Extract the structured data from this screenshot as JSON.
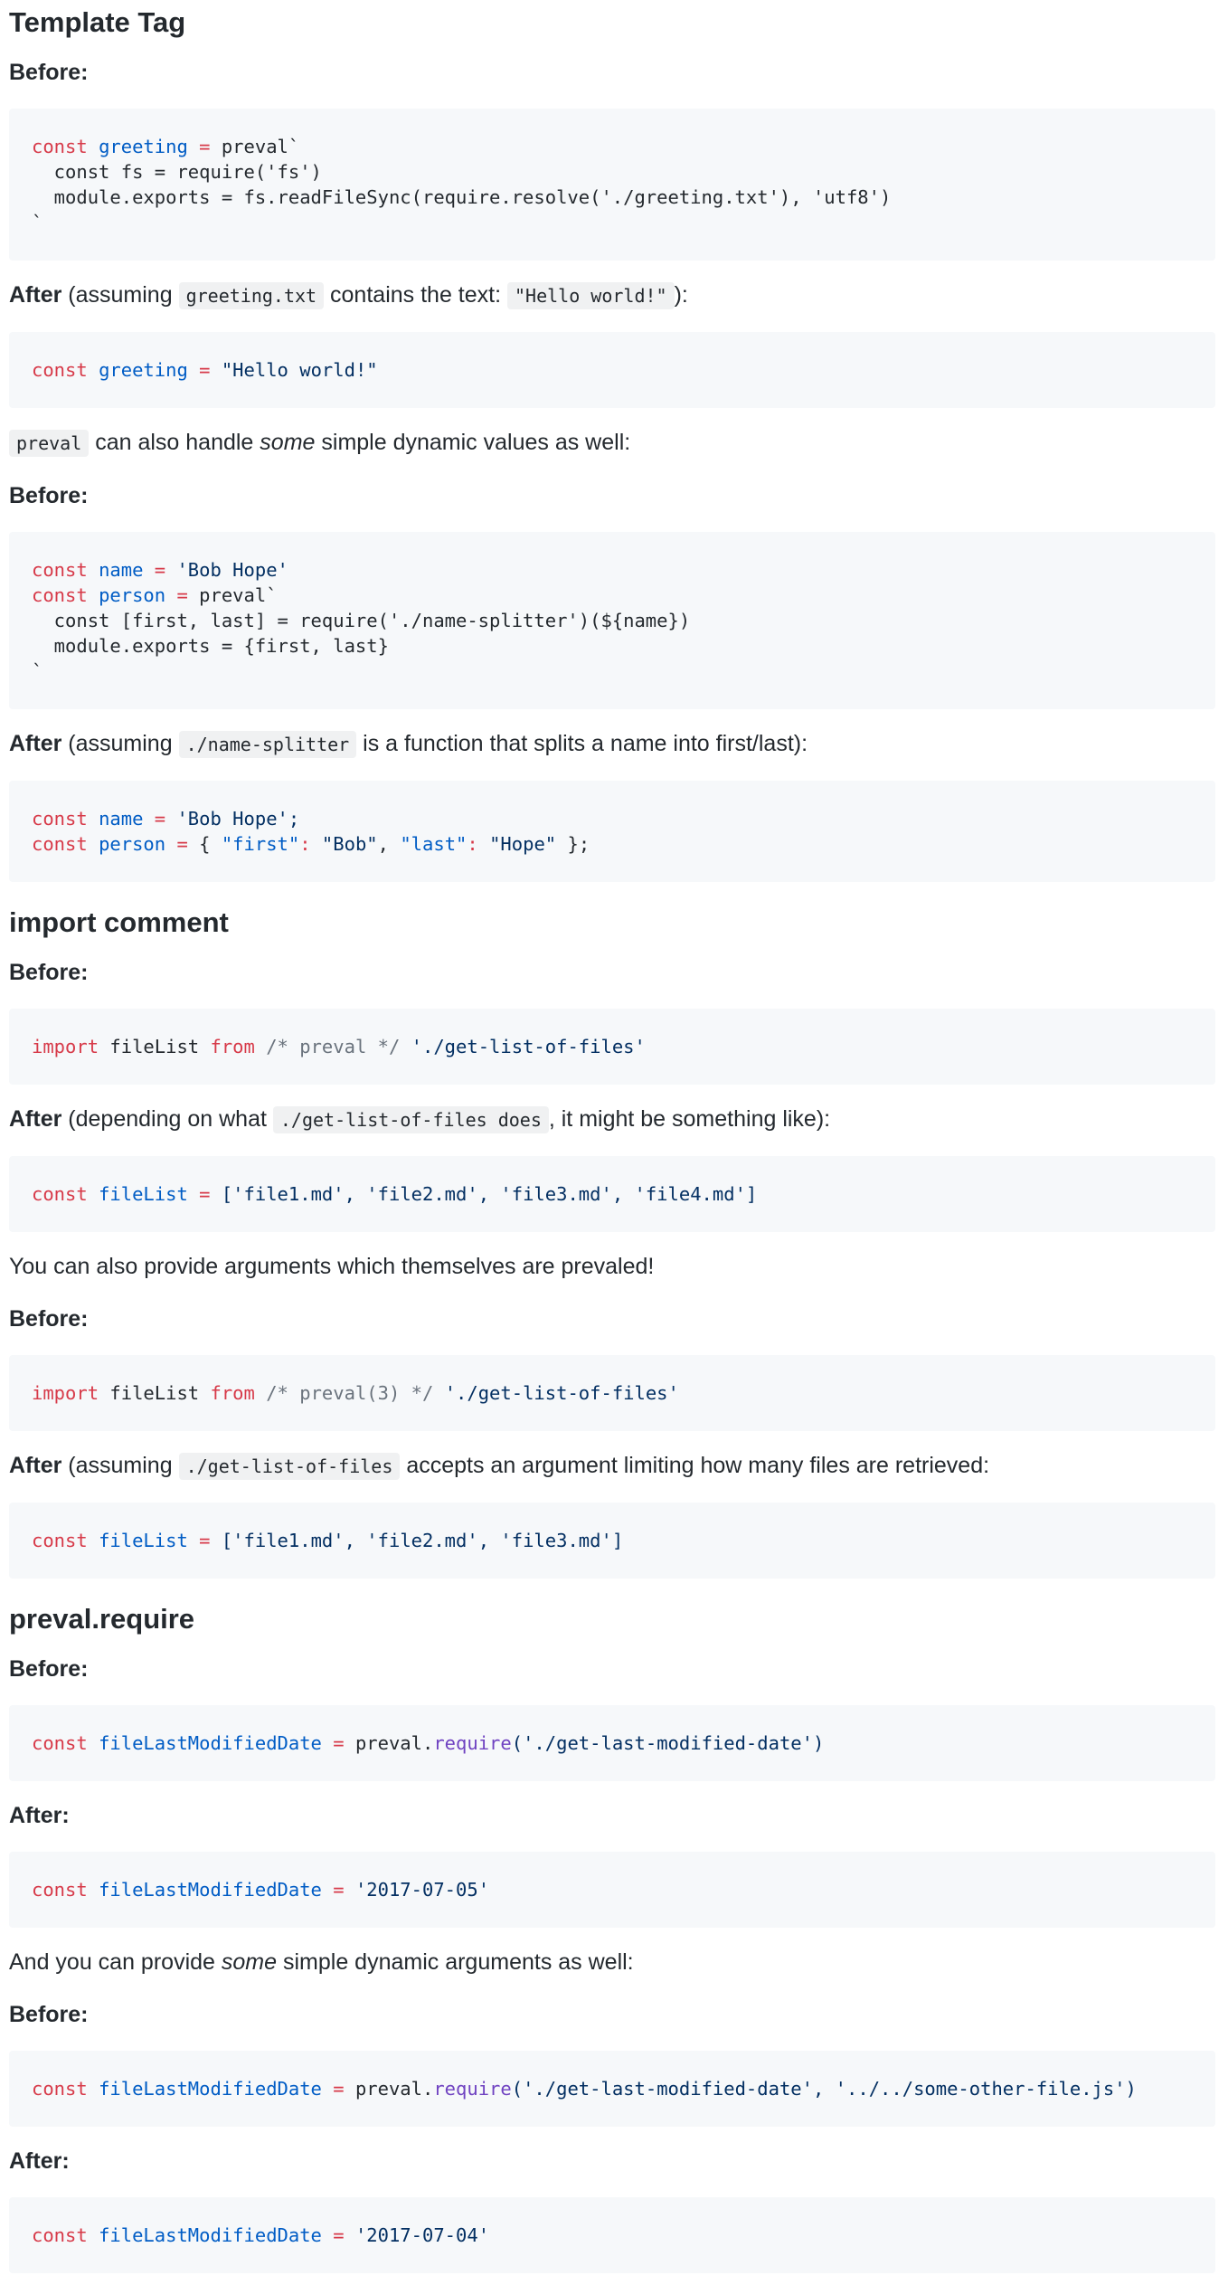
{
  "sections": {
    "template_tag": {
      "heading": "Template Tag",
      "before_label": "Before:",
      "code1": {
        "kw": "const",
        "var": "greeting",
        "eq": "=",
        "rest": "preval`",
        "line2": "  const fs = require('fs')",
        "line3": "  module.exports = fs.readFileSync(require.resolve('./greeting.txt'), 'utf8')",
        "line4": "`"
      },
      "after_label": "After",
      "after_text_1": "(assuming",
      "after_code_1": "greeting.txt",
      "after_text_2": "contains the text:",
      "after_code_2": "\"Hello world!\"",
      "after_text_3": "):",
      "code2": {
        "kw": "const",
        "var": "greeting",
        "eq": "=",
        "str": "\"Hello world!\""
      },
      "dyn_code": "preval",
      "dyn_text_1": "can also handle",
      "dyn_em": "some",
      "dyn_text_2": "simple dynamic values as well:",
      "before_label_2": "Before:",
      "code3": {
        "l1_kw": "const",
        "l1_var": "name",
        "l1_eq": "=",
        "l1_str": "'Bob Hope'",
        "l2_kw": "const",
        "l2_var": "person",
        "l2_eq": "=",
        "l2_rest": "preval`",
        "line3": "  const [first, last] = require('./name-splitter')(${name})",
        "line4": "  module.exports = {first, last}",
        "line5": "`"
      },
      "after_label_2": "After",
      "after2_text_1": "(assuming",
      "after2_code": "./name-splitter",
      "after2_text_2": "is a function that splits a name into first/last):",
      "code4": {
        "l1_kw": "const",
        "l1_var": "name",
        "l1_eq": "=",
        "l1_str": "'Bob Hope';",
        "l2_kw": "const",
        "l2_var": "person",
        "l2_eq": "=",
        "l2_p1": "{ ",
        "l2_s1": "\"first\"",
        "l2_c1": ":",
        "l2_s2": " \"Bob\"",
        "l2_p2": ", ",
        "l2_s3": "\"last\"",
        "l2_c2": ":",
        "l2_s4": " \"Hope\"",
        "l2_p3": " };"
      }
    },
    "import_comment": {
      "heading": "import comment",
      "before_label": "Before:",
      "code1": {
        "kw": "import",
        "name": " fileList ",
        "from": "from",
        "comment": " /* preval */ ",
        "str": "'./get-list-of-files'"
      },
      "after_label": "After",
      "after_text_1": "(depending on what",
      "after_code": "./get-list-of-files does",
      "after_text_2": ", it might be something like):",
      "code2": {
        "kw": "const",
        "var": "fileList",
        "eq": "=",
        "str": "['file1.md', 'file2.md', 'file3.md', 'file4.md']"
      },
      "args_text": "You can also provide arguments which themselves are prevaled!",
      "before_label_2": "Before:",
      "code3": {
        "kw": "import",
        "name": " fileList ",
        "from": "from",
        "comment": " /* preval(3) */ ",
        "str": "'./get-list-of-files'"
      },
      "after_label_2": "After",
      "after2_text_1": "(assuming",
      "after2_code": "./get-list-of-files",
      "after2_text_2": "accepts an argument limiting how many files are retrieved:",
      "code4": {
        "kw": "const",
        "var": "fileList",
        "eq": "=",
        "str": "['file1.md', 'file2.md', 'file3.md']"
      }
    },
    "preval_require": {
      "heading": "preval.require",
      "before_label": "Before:",
      "code1": {
        "kw": "const",
        "var": "fileLastModifiedDate",
        "eq": "=",
        "obj": "preval.",
        "fn": "require",
        "args": "('./get-last-modified-date')"
      },
      "after_label": "After:",
      "code2": {
        "kw": "const",
        "var": "fileLastModifiedDate",
        "eq": "=",
        "str": "'2017-07-05'"
      },
      "dyn_text_1": "And you can provide",
      "dyn_em": "some",
      "dyn_text_2": "simple dynamic arguments as well:",
      "before_label_2": "Before:",
      "code3": {
        "kw": "const",
        "var": "fileLastModifiedDate",
        "eq": "=",
        "obj": "preval.",
        "fn": "require",
        "args": "('./get-last-modified-date', '../../some-other-file.js')"
      },
      "after_label_2": "After:",
      "code4": {
        "kw": "const",
        "var": "fileLastModifiedDate",
        "eq": "=",
        "str": "'2017-07-04'"
      }
    }
  }
}
